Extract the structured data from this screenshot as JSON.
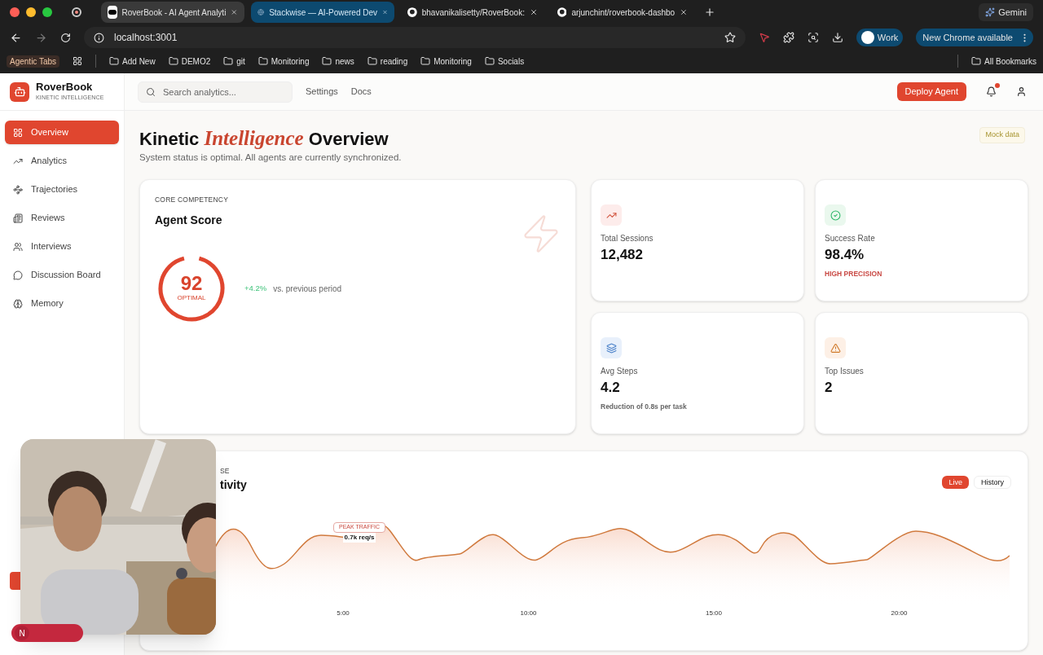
{
  "browser": {
    "tabs": [
      {
        "title": "RoverBook - AI Agent Analyti",
        "selected": true,
        "grouped": false
      },
      {
        "title": "Stackwise — AI-Powered Dev",
        "selected": false,
        "grouped": true
      },
      {
        "title": "bhavanikalisetty/RoverBook: ",
        "selected": false,
        "grouped": false
      },
      {
        "title": "arjunchint/roverbook-dashbo",
        "selected": false,
        "grouped": false
      }
    ],
    "gemini": "Gemini",
    "address": "localhost:3001",
    "profile": "Work",
    "update": "New Chrome available",
    "bookmarks_label": "Agentic Tabs",
    "bookmarks": [
      "Add New",
      "DEMO2",
      "git",
      "Monitoring",
      "news",
      "reading",
      "Monitoring",
      "Socials"
    ],
    "all_bookmarks": "All Bookmarks"
  },
  "app": {
    "brand": "RoverBook",
    "tagline": "KINETIC INTELLIGENCE",
    "search": {
      "placeholder": "Search analytics..."
    },
    "nav_links": [
      "Settings",
      "Docs"
    ],
    "deploy_button": "Deploy Agent",
    "notifications_unread": true,
    "sidebar": {
      "items": [
        {
          "label": "Overview",
          "selected": true
        },
        {
          "label": "Analytics",
          "selected": false
        },
        {
          "label": "Trajectories",
          "selected": false
        },
        {
          "label": "Reviews",
          "selected": false
        },
        {
          "label": "Interviews",
          "selected": false
        },
        {
          "label": "Discussion Board",
          "selected": false
        },
        {
          "label": "Memory",
          "selected": false
        }
      ]
    },
    "title_parts": [
      {
        "text": "Kinetic ",
        "kind": "plain"
      },
      {
        "text": "Intelligence",
        "kind": "accent"
      },
      {
        "text": " Overview",
        "kind": "plain"
      }
    ],
    "subtitle": "System status is optimal. All agents are currently synchronized.",
    "mock_badge": "Mock data",
    "score_card": {
      "eyebrow": "CORE COMPETENCY",
      "title": "Agent Score",
      "score": "92",
      "status": "OPTIMAL",
      "level": 0.92,
      "change": "+4.2%",
      "comparison": "vs. previous period"
    },
    "stats": [
      {
        "label": "Total Sessions",
        "value": "12,482"
      },
      {
        "label": "Success Rate",
        "value": "98.4%",
        "note": {
          "text": "HIGH PRECISION",
          "color": "#c94a45"
        }
      },
      {
        "label": "Avg Steps",
        "value": "4.2",
        "note": {
          "text": "Reduction of 0.8s per task",
          "color": "#666666"
        }
      },
      {
        "label": "Top Issues",
        "value": "2"
      }
    ],
    "activity": {
      "eyebrow": "SE",
      "title": "tivity",
      "toggles": [
        {
          "label": "Live",
          "selected": true
        },
        {
          "label": "History",
          "selected": false
        }
      ],
      "peak_label": "PEAK TRAFFIC",
      "peak_value": "0.7k req/s",
      "x_labels": [
        "5:00",
        "10:00",
        "15:00",
        "20:00"
      ]
    },
    "webcam": {
      "kind": "picture"
    },
    "dev_indicator": "N"
  }
}
